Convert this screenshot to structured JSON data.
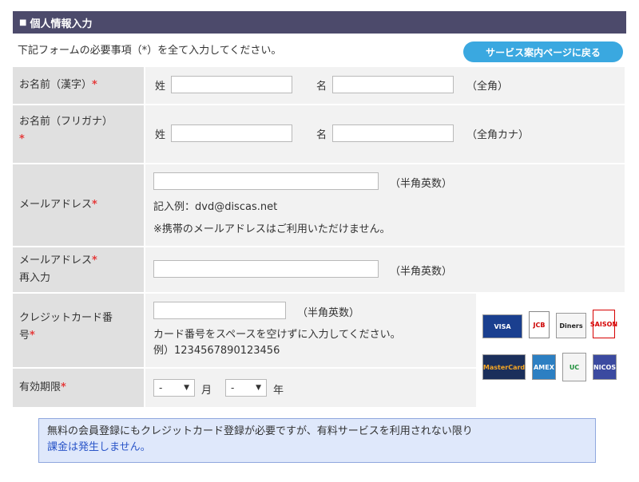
{
  "header": {
    "bullet": "■",
    "title": "個人情報入力"
  },
  "intro": "下記フォームの必要事項（*）を全て入力してください。",
  "service_button": "サービス案内ページに戻る",
  "required_mark": "*",
  "rows": {
    "name_kanji": {
      "label": "お名前（漢字）",
      "sei": "姓",
      "mei": "名",
      "note": "（全角）"
    },
    "name_kana": {
      "label": "お名前（フリガナ）",
      "sei": "姓",
      "mei": "名",
      "note": "（全角カナ）"
    },
    "email": {
      "label": "メールアドレス",
      "note": "（半角英数）",
      "example": "記入例：dvd@discas.net",
      "warning": "※携帯のメールアドレスはご利用いただけません。"
    },
    "email_confirm": {
      "label_line1": "メールアドレス",
      "label_line2": "再入力",
      "note": "（半角英数）"
    },
    "card_number": {
      "label_line1": "クレジットカード番",
      "label_line2": "号",
      "note": "（半角英数）",
      "hint": "カード番号をスペースを空けずに入力してください。",
      "example": "例）1234567890123456"
    },
    "expiry": {
      "label": "有効期限",
      "month_value": "-",
      "month_unit": "月",
      "year_value": "-",
      "year_unit": "年"
    }
  },
  "cards": {
    "visa": "VISA",
    "jcb": "JCB",
    "diners": "Diners",
    "saison": "SAISON",
    "mastercard": "MasterCard",
    "amex": "AMEX",
    "uc": "UC",
    "nicos": "NICOS"
  },
  "notice": {
    "line1": "無料の会員登録にもクレジットカード登録が必要ですが、有料サービスを利用されない限り",
    "line2": "課金は発生しません。"
  },
  "colors": {
    "header_bg": "#4c4a6b",
    "button_bg": "#3aa8e0",
    "label_bg": "#e0e0e0",
    "value_bg": "#f2f2f2",
    "required": "#e53b3b",
    "notice_bg": "#dfe8fb",
    "notice_link": "#2a55c8"
  }
}
